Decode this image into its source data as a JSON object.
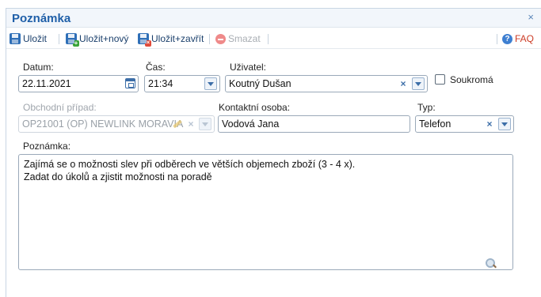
{
  "window": {
    "title": "Poznámka",
    "close_label": "×"
  },
  "toolbar": {
    "save": "Uložit",
    "save_new": "Uložit+nový",
    "save_close": "Uložit+zavřít",
    "delete": "Smazat",
    "faq": "FAQ",
    "separator": "|"
  },
  "form": {
    "date": {
      "label": "Datum:",
      "value": "22.11.2021"
    },
    "time": {
      "label": "Čas:",
      "value": "21:34"
    },
    "user": {
      "label": "Uživatel:",
      "value": "Koutný Dušan"
    },
    "private": {
      "label": "Soukromá",
      "checked": false
    },
    "business_case": {
      "label": "Obchodní případ:",
      "value": "OP21001 (OP) NEWLINK MORAVIA"
    },
    "contact": {
      "label": "Kontaktní osoba:",
      "value": "Vodová Jana"
    },
    "type": {
      "label": "Typ:",
      "value": "Telefon"
    },
    "note": {
      "label": "Poznámka:",
      "lines": [
        "Zajímá se o možnosti slev při odběrech ve větších objemech zboží (3 - 4 x).",
        "Zadat do úkolů a zjistit možnosti na poradě"
      ]
    }
  },
  "icons": {
    "floppy": "floppy-disk-icon",
    "delete": "delete-icon",
    "help": "help-icon",
    "calendar": "calendar-icon",
    "clear": "clear-icon",
    "dropdown": "chevron-down-icon",
    "edit": "pencil-icon",
    "search": "magnifier-icon"
  },
  "colors": {
    "title": "#1f5fa8",
    "faq": "#cc3b25",
    "accent": "#3c6ea8"
  }
}
